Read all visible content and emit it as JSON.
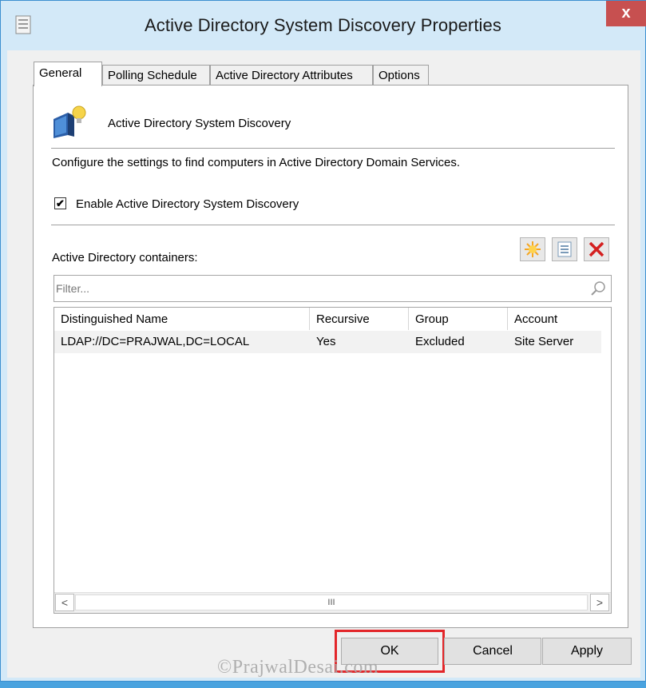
{
  "window": {
    "title": "Active Directory System Discovery Properties",
    "close_glyph": "x"
  },
  "tabs": [
    {
      "label": "General",
      "active": true
    },
    {
      "label": "Polling Schedule",
      "active": false
    },
    {
      "label": "Active Directory Attributes",
      "active": false
    },
    {
      "label": "Options",
      "active": false
    }
  ],
  "general": {
    "heading": "Active Directory System Discovery",
    "description": "Configure the settings to find computers in Active Directory Domain Services.",
    "enable_label": "Enable Active Directory System Discovery",
    "enable_checked": true,
    "check_glyph": "✔",
    "containers_label": "Active Directory containers:",
    "filter_placeholder": "Filter...",
    "toolbar_icons": [
      "new-starburst-icon",
      "properties-icon",
      "delete-x-icon"
    ],
    "table": {
      "columns": [
        "Distinguished Name",
        "Recursive",
        "Group",
        "Account"
      ],
      "rows": [
        [
          "LDAP://DC=PRAJWAL,DC=LOCAL",
          "Yes",
          "Excluded",
          "Site Server"
        ]
      ]
    },
    "scroll_left": "<",
    "scroll_right": ">",
    "scroll_grip": "III"
  },
  "buttons": {
    "ok": "OK",
    "cancel": "Cancel",
    "apply": "Apply"
  },
  "watermark": "©PrajwalDesai.com",
  "colors": {
    "highlight": "#e3262a",
    "titlebar": "#d3e9f8",
    "close": "#c75050",
    "delete": "#d42020",
    "new": "#f5a623"
  }
}
